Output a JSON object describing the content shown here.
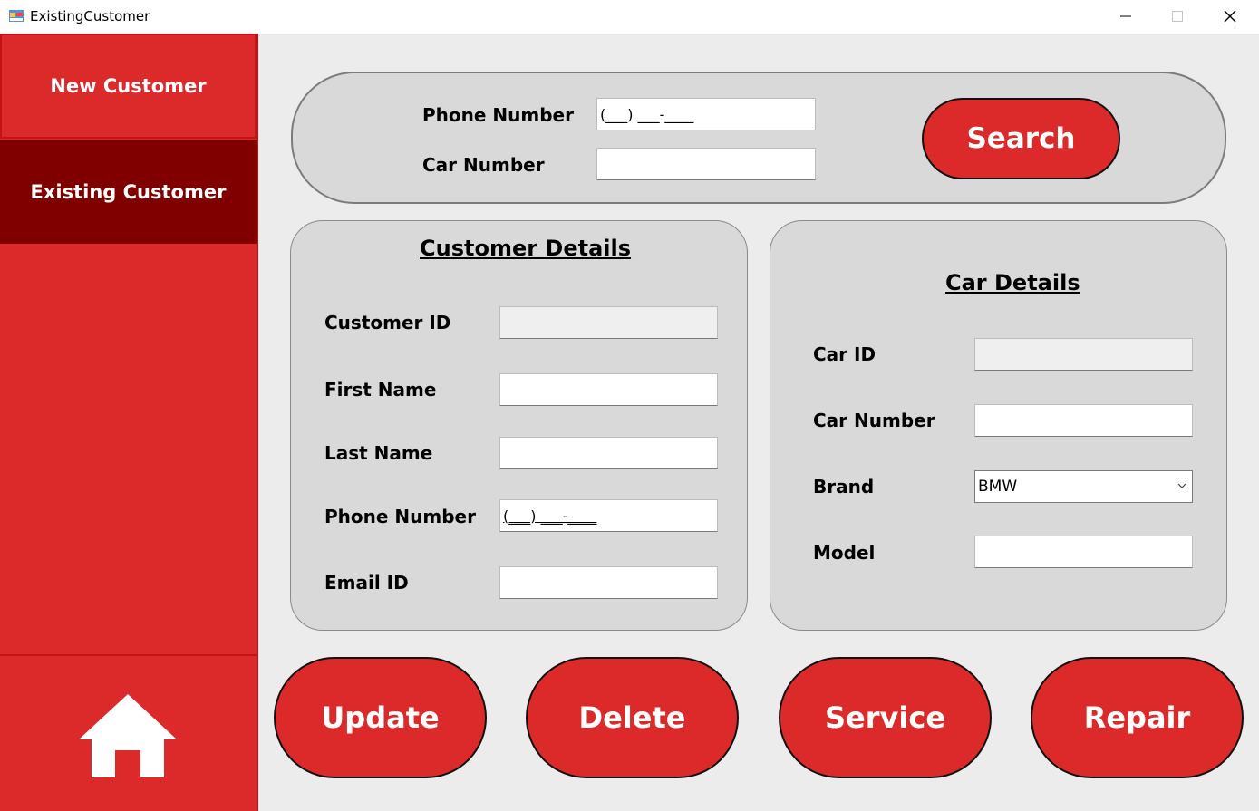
{
  "window": {
    "title": "ExistingCustomer",
    "icons": {
      "app": "form-app-icon",
      "minimize": "minimize-icon",
      "maximize": "maximize-icon",
      "close": "close-icon"
    }
  },
  "sidebar": {
    "new_customer": "New Customer",
    "existing_customer": "Existing Customer",
    "home_icon": "home-icon",
    "colors": {
      "sidebar": "#dc2a2a",
      "active": "#800000"
    }
  },
  "search": {
    "phone_label": "Phone Number",
    "phone_value": "(___) ___-____",
    "car_label": "Car Number",
    "car_value": "",
    "button": "Search"
  },
  "customer": {
    "heading": "Customer Details",
    "id_label": "Customer ID",
    "id_value": "",
    "first_name_label": "First Name",
    "first_name_value": "",
    "last_name_label": "Last Name",
    "last_name_value": "",
    "phone_label": "Phone Number",
    "phone_value": "(___) ___-____",
    "email_label": "Email ID",
    "email_value": ""
  },
  "car": {
    "heading": "Car Details",
    "id_label": "Car ID",
    "id_value": "",
    "number_label": "Car Number",
    "number_value": "",
    "brand_label": "Brand",
    "brand_value": "BMW",
    "model_label": "Model",
    "model_value": ""
  },
  "actions": {
    "update": "Update",
    "delete": "Delete",
    "service": "Service",
    "repair": "Repair"
  },
  "colors": {
    "accent": "#dc2a2a",
    "panel": "#d9d9d9",
    "background": "#ececec"
  }
}
